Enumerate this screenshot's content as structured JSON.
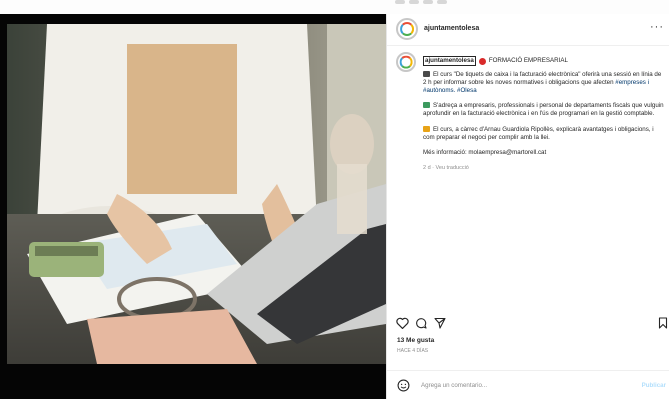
{
  "post": {
    "username": "ajuntamentolesa",
    "more_icon": "···",
    "caption": {
      "username": "ajuntamentolesa",
      "category": "FORMACIÓ EMPRESARIAL",
      "p1_text": "El curs \"De tiquets de caixa i la facturació electrònica\" oferirà una sessió en línia de 2 h per informar sobre les noves normatives i obligacions que afecten ",
      "p1_tags": "#empreses i #autònoms. #Olesa",
      "p2_text": "S'adreça a empresaris, professionals i personal de departaments fiscals que vulguin aprofundir en la facturació electrònica i en l'ús de programari en la gestió comptable.",
      "p3_text": "El curs, a càrrec d'Arnau Guardiola Ripollès, explicarà avantatges i obligacions, i com preparar el negoci per complir amb la llei.",
      "p4_text": "Més informació: molaempresa@martorell.cat",
      "meta": "2 d · Veu traducció"
    },
    "likes": "13 Me gusta",
    "time_ago": "Hace 4 días",
    "comment_placeholder": "Agrega un comentario...",
    "publish_label": "Publicar"
  },
  "colors": {
    "link": "#00376b",
    "publish": "#b2dffc",
    "dot": "#d92a2a"
  },
  "icons": [
    "heart-icon",
    "comment-icon",
    "share-icon",
    "bookmark-icon",
    "emoji-icon",
    "more-icon"
  ]
}
